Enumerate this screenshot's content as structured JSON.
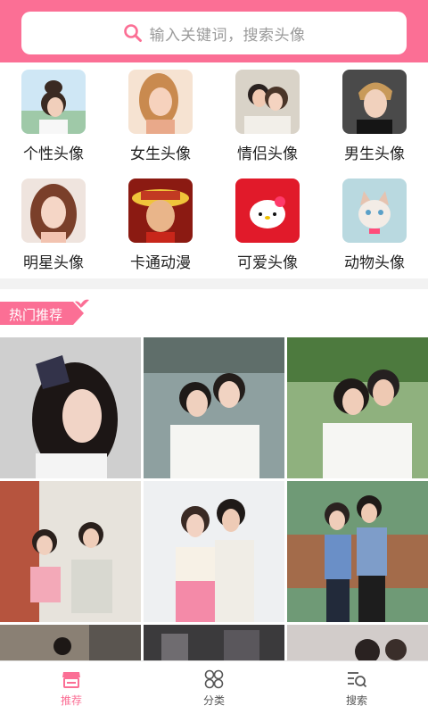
{
  "colors": {
    "brand": "#fb6f95",
    "text": "#222222",
    "muted": "#9a9a9a"
  },
  "search": {
    "placeholder": "输入关键词，搜索头像",
    "icon": "search-icon"
  },
  "categories": [
    {
      "label": "个性头像",
      "icon": "girl-bun-thumb"
    },
    {
      "label": "女生头像",
      "icon": "girl-thumb"
    },
    {
      "label": "情侣头像",
      "icon": "couple-thumb"
    },
    {
      "label": "男生头像",
      "icon": "boy-thumb"
    },
    {
      "label": "明星头像",
      "icon": "star-thumb"
    },
    {
      "label": "卡通动漫",
      "icon": "luffy-thumb"
    },
    {
      "label": "可爱头像",
      "icon": "hello-kitty-thumb"
    },
    {
      "label": "动物头像",
      "icon": "cat-thumb"
    }
  ],
  "hot": {
    "label": "热门推荐"
  },
  "nav": {
    "items": [
      {
        "label": "推荐",
        "icon": "shop-icon",
        "active": true
      },
      {
        "label": "分类",
        "icon": "grid-icon",
        "active": false
      },
      {
        "label": "搜索",
        "icon": "list-search-icon",
        "active": false
      }
    ]
  }
}
